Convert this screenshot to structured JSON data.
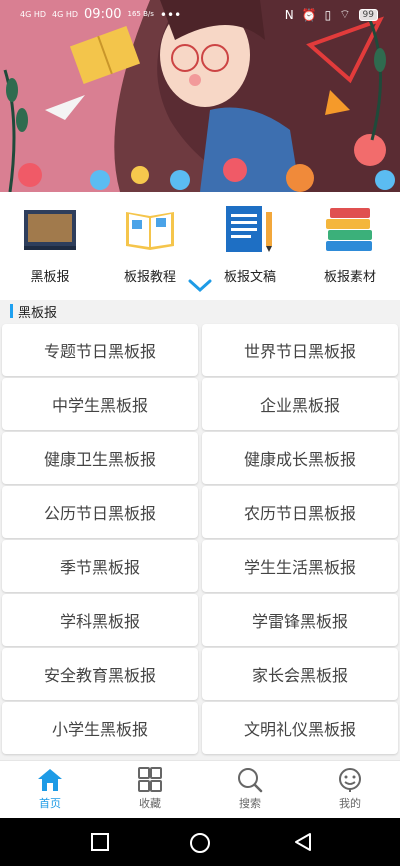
{
  "status_bar": {
    "signal_1": "4G HD",
    "signal_2": "4G HD",
    "time": "09:00",
    "speed": "165 B/s",
    "more": "•••",
    "battery": "99"
  },
  "categories": [
    {
      "label": "黑板报",
      "icon": "blackboard-icon"
    },
    {
      "label": "板报教程",
      "icon": "open-book-icon"
    },
    {
      "label": "板报文稿",
      "icon": "notebook-pencil-icon"
    },
    {
      "label": "板报素材",
      "icon": "book-stack-icon"
    }
  ],
  "section": {
    "title": "黑板报"
  },
  "items": [
    "专题节日黑板报",
    "世界节日黑板报",
    "中学生黑板报",
    "企业黑板报",
    "健康卫生黑板报",
    "健康成长黑板报",
    "公历节日黑板报",
    "农历节日黑板报",
    "季节黑板报",
    "学生生活黑板报",
    "学科黑板报",
    "学雷锋黑板报",
    "安全教育黑板报",
    "家长会黑板报",
    "小学生黑板报",
    "文明礼仪黑板报"
  ],
  "tabs": [
    {
      "label": "首页",
      "icon": "home-icon",
      "active": true
    },
    {
      "label": "收藏",
      "icon": "grid-icon",
      "active": false
    },
    {
      "label": "搜索",
      "icon": "search-icon",
      "active": false
    },
    {
      "label": "我的",
      "icon": "profile-icon",
      "active": false
    }
  ],
  "colors": {
    "accent": "#1e9be6",
    "section_bar": "#1ea0f0"
  }
}
